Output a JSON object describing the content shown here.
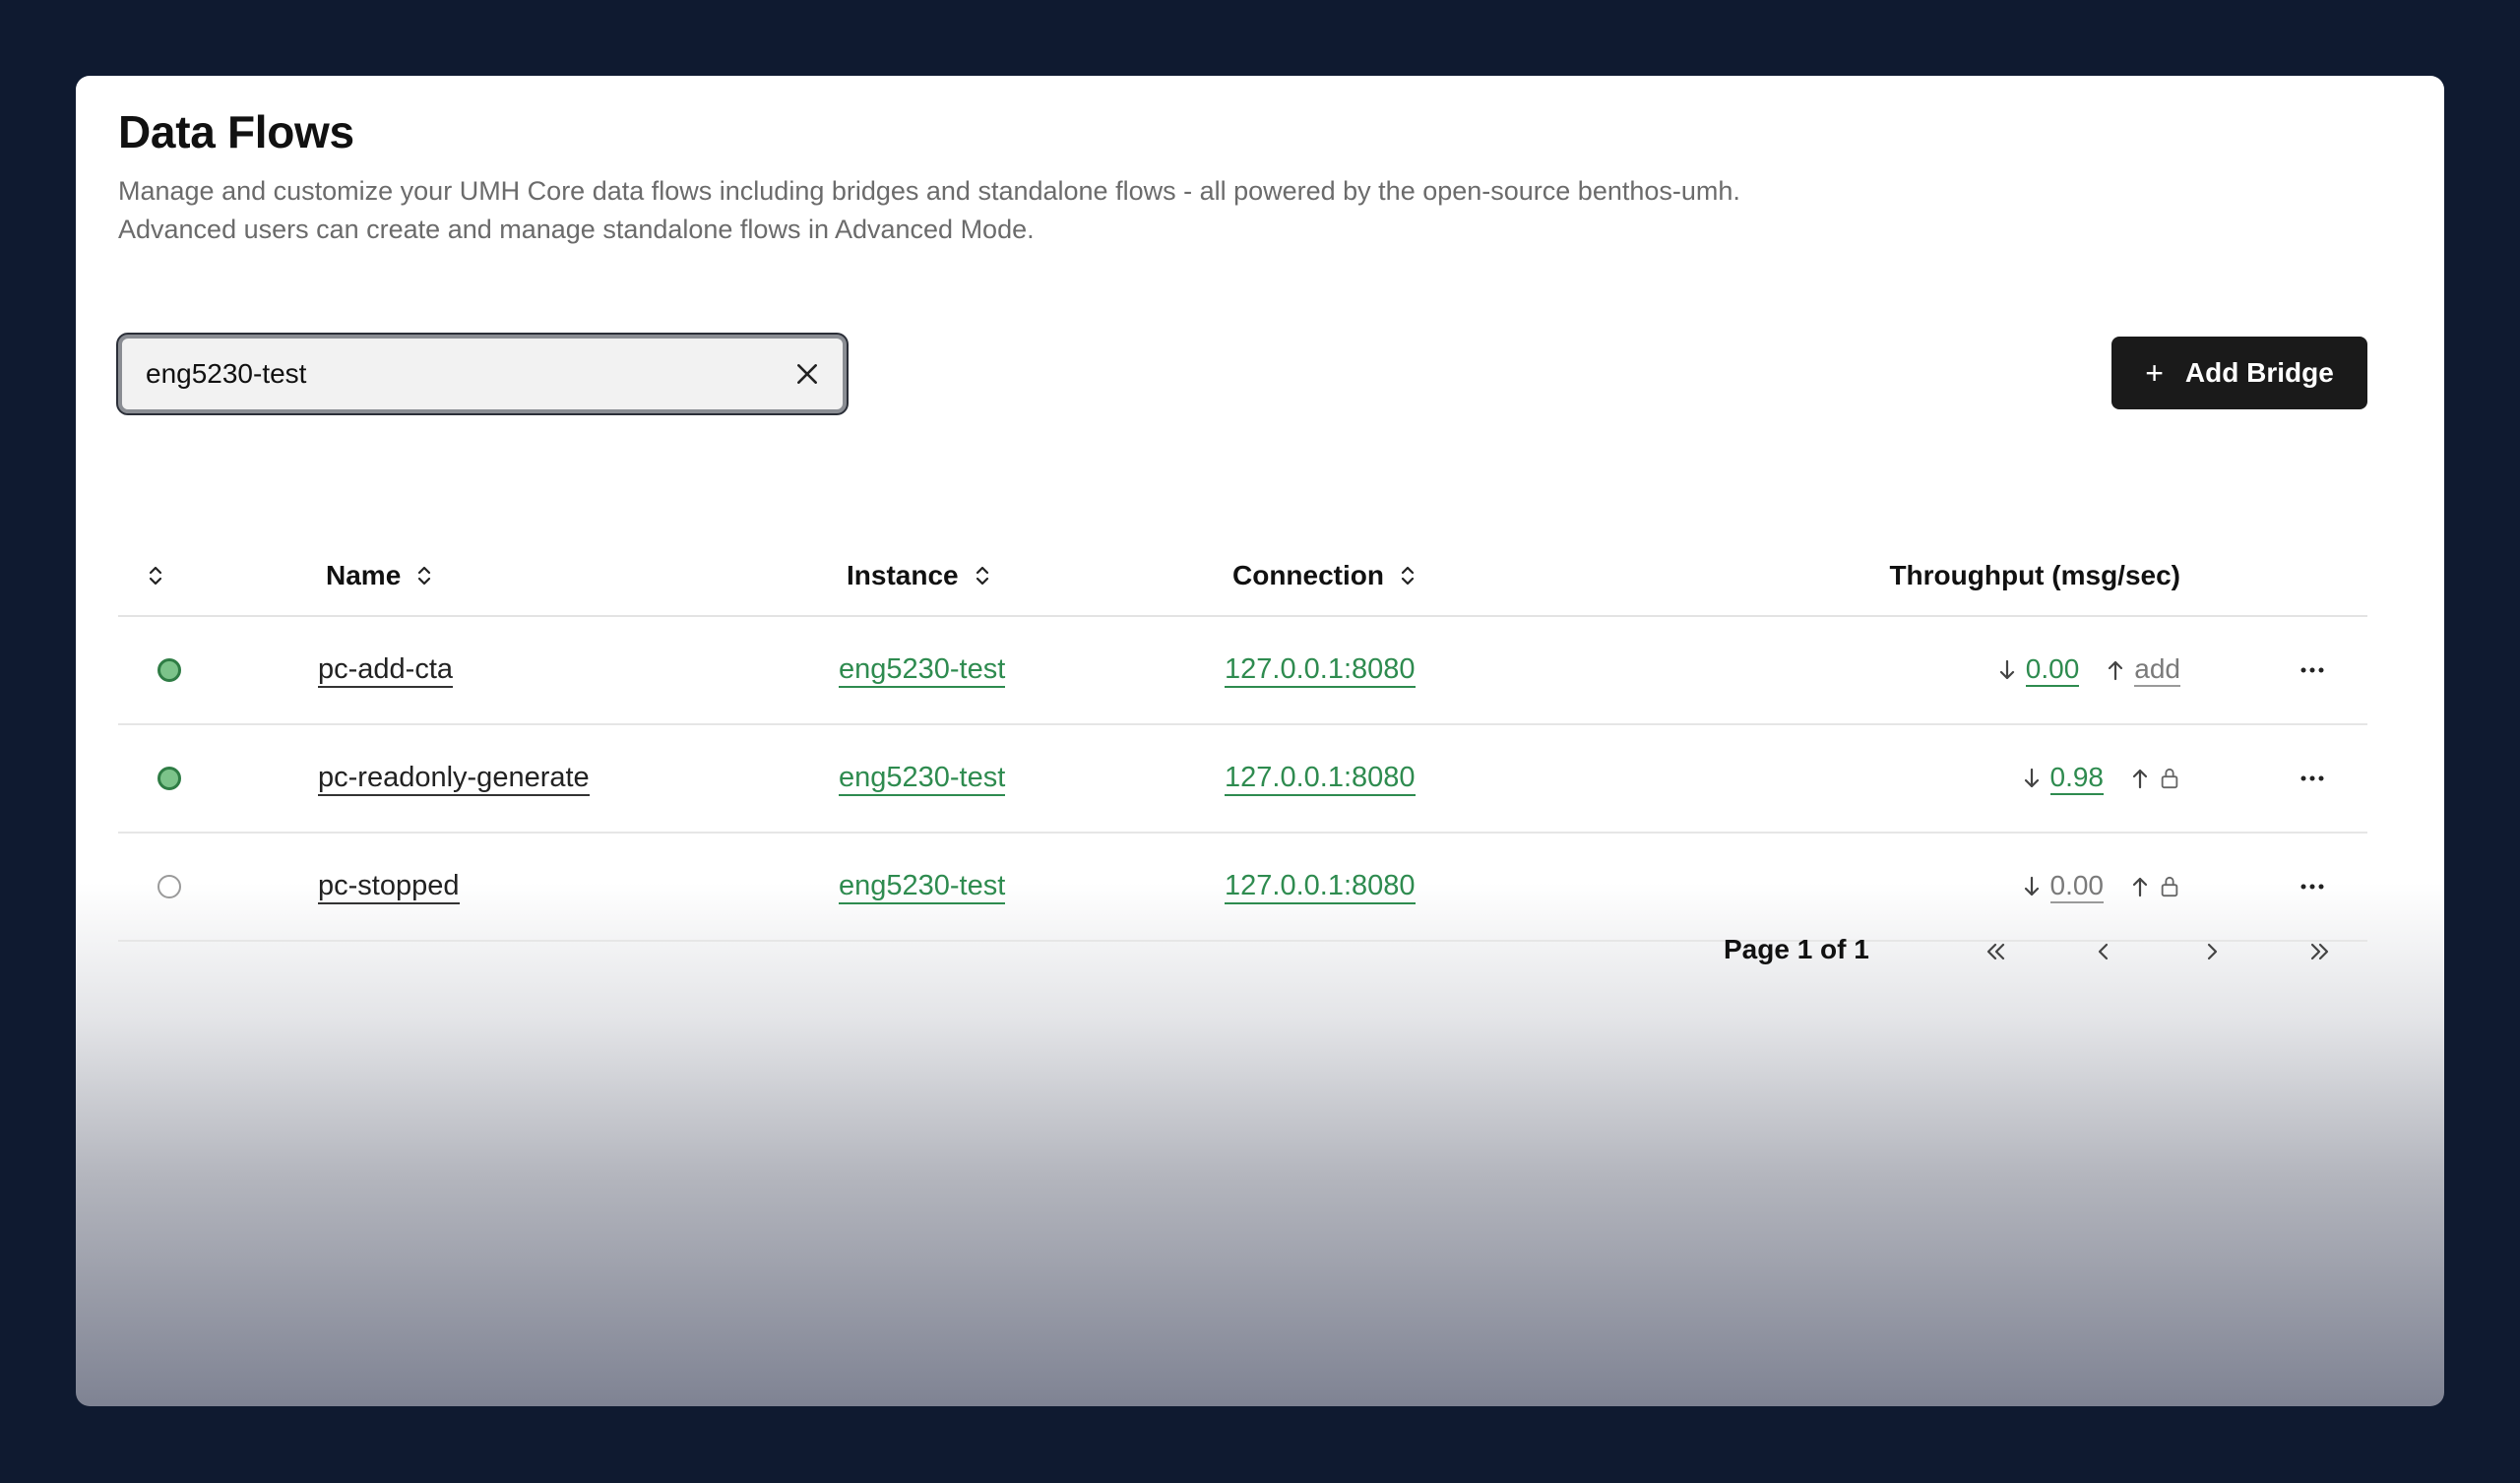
{
  "header": {
    "title": "Data Flows",
    "description_line1": "Manage and customize your UMH Core data flows including bridges and standalone flows - all powered by the open-source benthos-umh.",
    "description_line2": "Advanced users can create and manage standalone flows in Advanced Mode."
  },
  "search": {
    "value": "eng5230-test",
    "clear_icon": "close-icon"
  },
  "toolbar": {
    "add_bridge_label": "Add Bridge",
    "add_bridge_icon": "plus-icon"
  },
  "table": {
    "columns": {
      "status": "",
      "name": "Name",
      "instance": "Instance",
      "connection": "Connection",
      "throughput": "Throughput (msg/sec)"
    },
    "rows": [
      {
        "status": "running",
        "name": "pc-add-cta",
        "instance": "eng5230-test",
        "connection": "127.0.0.1:8080",
        "in": "0.00",
        "out": "add",
        "out_type": "add"
      },
      {
        "status": "running",
        "name": "pc-readonly-generate",
        "instance": "eng5230-test",
        "connection": "127.0.0.1:8080",
        "in": "0.98",
        "out": "",
        "out_type": "lock"
      },
      {
        "status": "stopped",
        "name": "pc-stopped",
        "instance": "eng5230-test",
        "connection": "127.0.0.1:8080",
        "in": "0.00",
        "out": "",
        "out_type": "lock"
      }
    ]
  },
  "pagination": {
    "label": "Page 1 of 1"
  },
  "colors": {
    "background": "#0f1a30",
    "accent_green": "#2e8b4f",
    "button_dark": "#1a1a1a"
  }
}
